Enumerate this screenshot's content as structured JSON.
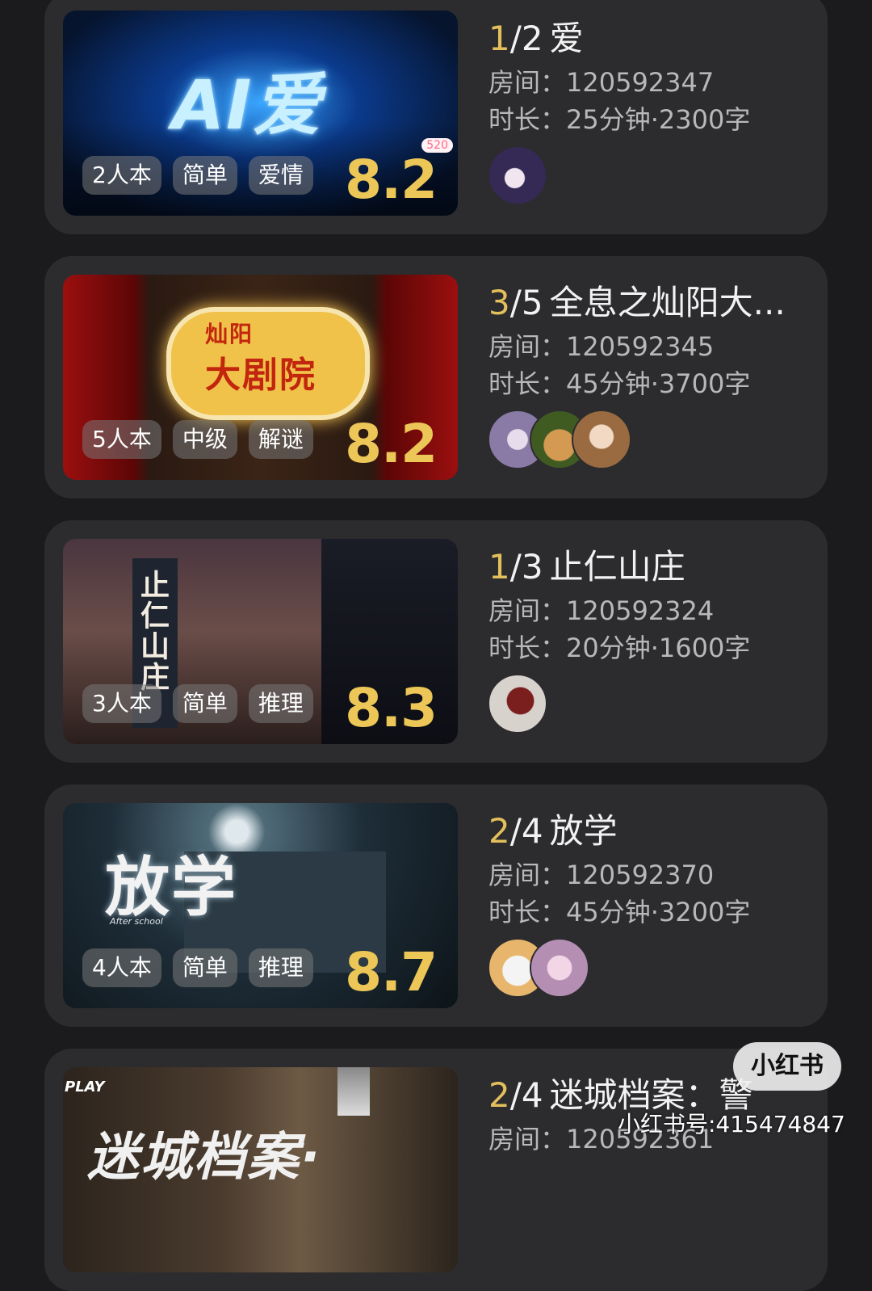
{
  "rooms": [
    {
      "current": "1",
      "sep": "/",
      "total": "2",
      "name": "爱",
      "room_line": "房间：120592347",
      "duration_line": "时长：25分钟·2300字",
      "tags": [
        "2人本",
        "简单",
        "爱情"
      ],
      "score": "8.2",
      "cover_text": "AI爱",
      "cover_badge": "520",
      "avatar_count": 1
    },
    {
      "current": "3",
      "sep": "/",
      "total": "5",
      "name": "全息之灿阳大...",
      "room_line": "房间：120592345",
      "duration_line": "时长：45分钟·3700字",
      "tags": [
        "5人本",
        "中级",
        "解谜"
      ],
      "score": "8.2",
      "cover_text_1": "灿阳",
      "cover_text_2": "大剧院",
      "avatar_count": 3
    },
    {
      "current": "1",
      "sep": "/",
      "total": "3",
      "name": "止仁山庄",
      "room_line": "房间：120592324",
      "duration_line": "时长：20分钟·1600字",
      "tags": [
        "3人本",
        "简单",
        "推理"
      ],
      "score": "8.3",
      "cover_text": "止仁山庄",
      "avatar_count": 1
    },
    {
      "current": "2",
      "sep": "/",
      "total": "4",
      "name": "放学",
      "room_line": "房间：120592370",
      "duration_line": "时长：45分钟·3200字",
      "tags": [
        "4人本",
        "简单",
        "推理"
      ],
      "score": "8.7",
      "cover_text": "放学",
      "cover_sub": "After school",
      "avatar_count": 2
    },
    {
      "current": "2",
      "sep": "/",
      "total": "4",
      "name": "迷城档案：警",
      "room_line": "房间：120592361",
      "cover_text": "迷城档案·",
      "cover_badge": "PLAY"
    }
  ],
  "watermark": {
    "badge": "小红书",
    "id": "小红书号:415474847"
  },
  "colors": {
    "background": "#1b1b1d",
    "card": "#2c2c2f",
    "accent": "#e3c05b",
    "score": "#ecc657"
  }
}
